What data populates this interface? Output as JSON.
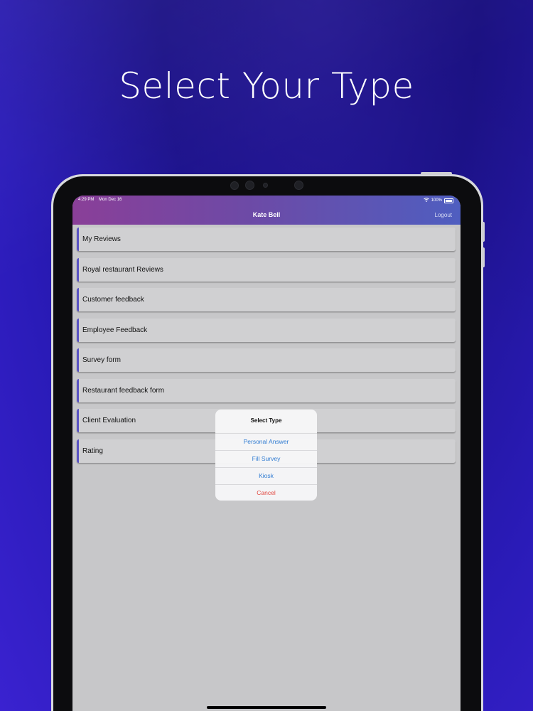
{
  "headline": "Select Your Type",
  "status_bar": {
    "time": "4:29 PM",
    "date": "Mon Dec 16",
    "battery": "100%",
    "wifi_icon": "wifi-icon",
    "battery_icon": "battery-icon"
  },
  "navbar": {
    "title": "Kate Bell",
    "logout_label": "Logout",
    "gradient": [
      "#8a3f98",
      "#4f5ec0"
    ]
  },
  "list": {
    "items": [
      {
        "label": "My Reviews"
      },
      {
        "label": "Royal restaurant Reviews"
      },
      {
        "label": "Customer feedback"
      },
      {
        "label": "Employee Feedback"
      },
      {
        "label": "Survey form"
      },
      {
        "label": "Restaurant feedback form"
      },
      {
        "label": "Client Evaluation"
      },
      {
        "label": "Rating"
      }
    ],
    "accent_color": "#5a54c4"
  },
  "alert": {
    "title": "Select Type",
    "options": [
      {
        "label": "Personal Answer"
      },
      {
        "label": "Fill Survey"
      },
      {
        "label": "Kiosk"
      }
    ],
    "cancel_label": "Cancel",
    "action_color": "#2f7bd2",
    "cancel_color": "#e2473f"
  }
}
